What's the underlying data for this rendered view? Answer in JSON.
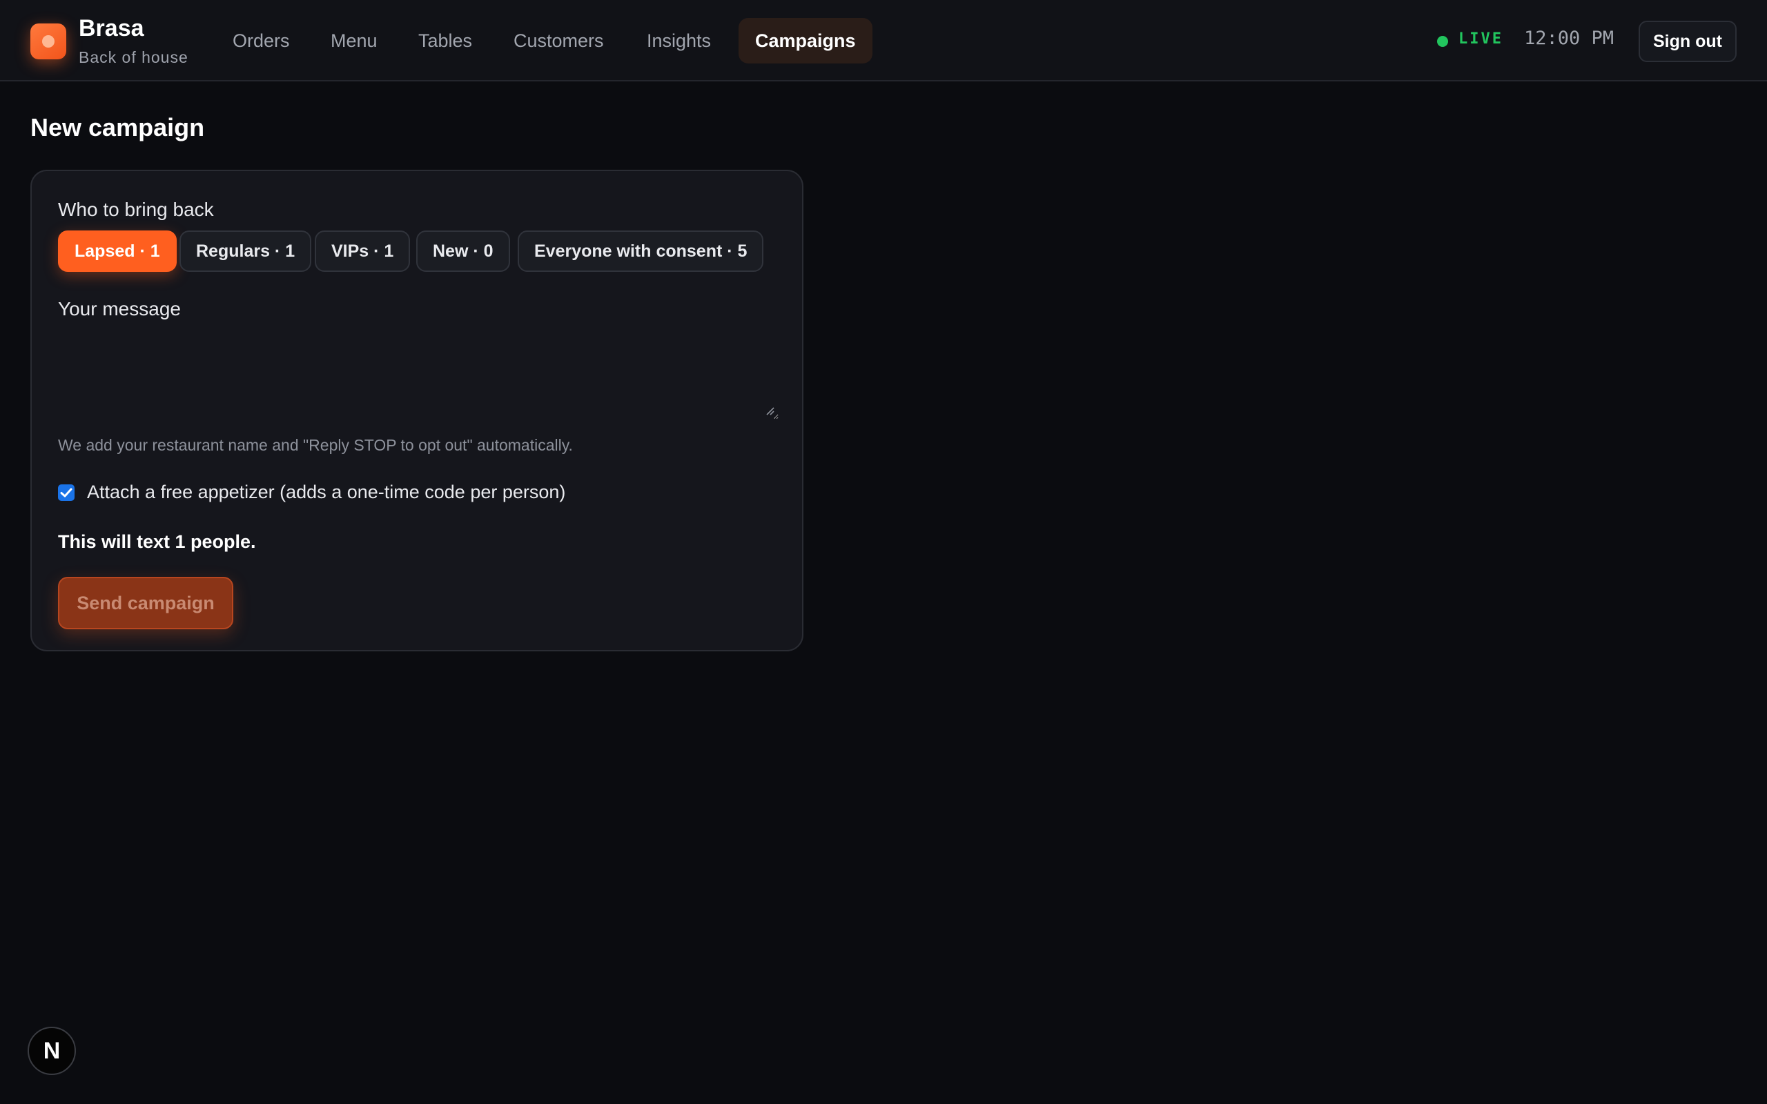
{
  "brand": {
    "name": "Brasa",
    "subtitle": "Back of house"
  },
  "nav": {
    "items": [
      {
        "label": "Orders"
      },
      {
        "label": "Menu"
      },
      {
        "label": "Tables"
      },
      {
        "label": "Customers"
      },
      {
        "label": "Insights"
      },
      {
        "label": "Campaigns",
        "active": true
      }
    ]
  },
  "status": {
    "live_label": "LIVE",
    "time": "12:00 PM",
    "live_color": "#22c55e"
  },
  "header": {
    "signout_label": "Sign out"
  },
  "page": {
    "title": "New campaign"
  },
  "campaign": {
    "audience_label": "Who to bring back",
    "segments": [
      {
        "label": "Lapsed · 1",
        "selected": true
      },
      {
        "label": "Regulars · 1",
        "selected": false
      },
      {
        "label": "VIPs · 1",
        "selected": false
      },
      {
        "label": "New · 0",
        "selected": false
      },
      {
        "label": "Everyone with consent · 5",
        "selected": false
      }
    ],
    "message_label": "Your message",
    "message_value": "",
    "hint": "We add your restaurant name and \"Reply STOP to opt out\" automatically.",
    "appetizer_label": "Attach a free appetizer (adds a one-time code per person)",
    "appetizer_checked": true,
    "summary": "This will text 1 people.",
    "send_label": "Send campaign"
  },
  "dev_badge": {
    "label": "N"
  },
  "colors": {
    "accent": "#ff5f1f",
    "background": "#0b0c10",
    "checkbox": "#1a73e8"
  }
}
